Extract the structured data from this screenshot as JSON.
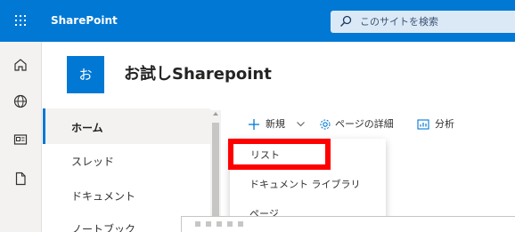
{
  "suite": {
    "app_name": "SharePoint",
    "search_placeholder": "このサイトを検索",
    "accent": "#0078d4"
  },
  "appbar": {
    "icons": [
      "home-icon",
      "globe-icon",
      "news-icon",
      "file-icon"
    ]
  },
  "site": {
    "logo_text": "お",
    "title": "お試しSharepoint"
  },
  "nav": {
    "items": [
      {
        "label": "ホーム",
        "active": true
      },
      {
        "label": "スレッド"
      },
      {
        "label": "ドキュメント"
      },
      {
        "label": "ノートブック"
      }
    ]
  },
  "commands": {
    "new_label": "新規",
    "page_details_label": "ページの詳細",
    "analytics_label": "分析"
  },
  "new_menu": {
    "items": [
      "リスト",
      "ドキュメント ライブラリ",
      "ページ"
    ],
    "highlight_color": "#ff0000"
  }
}
